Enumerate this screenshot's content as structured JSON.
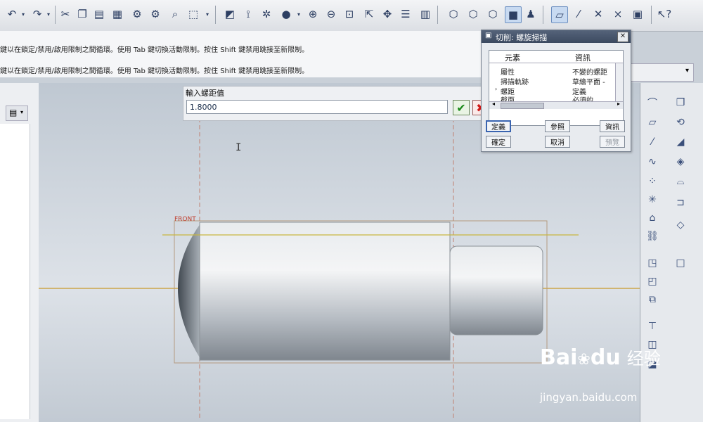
{
  "toolbar": {
    "icons": [
      "undo-icon",
      "redo-icon",
      "cut-icon",
      "copy-icon",
      "paste-icon",
      "paste-special-icon",
      "regenerate-icon",
      "find-icon",
      "select-box-icon",
      "named-view-icon",
      "datum-axis-icon",
      "spin-center-icon",
      "shading-icon",
      "zoom-in-icon",
      "zoom-out-icon",
      "refit-icon",
      "orient-icon",
      "layers-icon",
      "view-manager-icon",
      "wireframe-icon",
      "hidden-line-icon",
      "no-hidden-icon",
      "shaded-icon",
      "model-tree-icon",
      "datum-plane-icon",
      "datum-point-icon",
      "csys-icon",
      "annotation-icon",
      "whats-this-icon"
    ]
  },
  "messages": {
    "line1": "鍵以在鎖定/禁用/啟用限制之間循環。使用 Tab 鍵切換活動限制。按住 Shift 鍵禁用跳接至新限制。",
    "line2": "鍵以在鎖定/禁用/啟用限制之間循環。使用 Tab 鍵切換活動限制。按住 Shift 鍵禁用跳接至新限制。"
  },
  "pitch_prompt": {
    "label": "輸入螺距值",
    "value": "1.8000",
    "ok_glyph": "✔",
    "cancel_glyph": "✖"
  },
  "dialog": {
    "title": "切削: 螺旋掃描",
    "close_glyph": "✕",
    "headers": {
      "element": "元素",
      "info": "資訊"
    },
    "rows": [
      {
        "element": "屬性",
        "info": "不變的螺距"
      },
      {
        "element": "掃描軌跡",
        "info": "草繪平面 -"
      },
      {
        "element": "螺距",
        "info": "定義"
      },
      {
        "element": "截面",
        "info": "必須的"
      }
    ],
    "buttons": {
      "define": "定義",
      "reference": "參照",
      "info": "資訊",
      "ok": "確定",
      "cancel": "取消",
      "preview": "預覽"
    }
  },
  "viewport": {
    "datum_front": "FRONT"
  },
  "watermark": {
    "brand": "Bai",
    "brand2": "du",
    "cn": "经验",
    "url": "jingyan.baidu.com"
  }
}
